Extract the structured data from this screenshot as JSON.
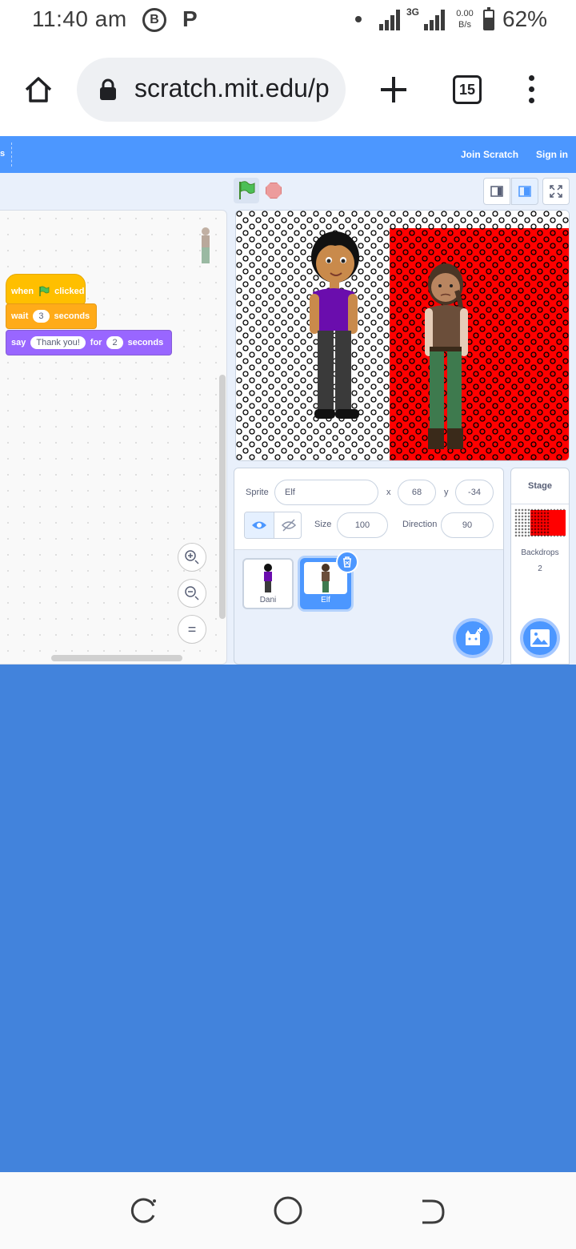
{
  "status_bar": {
    "time": "11:40 am",
    "icon_b": "B",
    "icon_p": "P",
    "network": "3G",
    "data_rate_value": "0.00",
    "data_rate_unit": "B/s",
    "battery_pct": "62%",
    "battery_level": 0.62
  },
  "browser": {
    "url": "scratch.mit.edu/p",
    "tab_count": "15"
  },
  "scratch": {
    "menu": {
      "cut_label": "s",
      "join": "Join Scratch",
      "sign_in": "Sign in"
    },
    "blocks": {
      "hat_when": "when",
      "hat_clicked": "clicked",
      "wait_label": "wait",
      "wait_value": "3",
      "wait_unit": "seconds",
      "say_label": "say",
      "say_value": "Thank you!",
      "say_for": "for",
      "say_secs_value": "2",
      "say_secs_unit": "seconds"
    },
    "zoom": {
      "zoom_in": "+",
      "zoom_out": "−",
      "reset": "="
    },
    "sprite_info": {
      "sprite_label": "Sprite",
      "sprite_name": "Elf",
      "x_label": "x",
      "x_value": "68",
      "y_label": "y",
      "y_value": "-34",
      "size_label": "Size",
      "size_value": "100",
      "direction_label": "Direction",
      "direction_value": "90"
    },
    "sprites": [
      {
        "name": "Dani",
        "selected": false
      },
      {
        "name": "Elf",
        "selected": true
      }
    ],
    "stage_panel": {
      "title": "Stage",
      "backdrops_label": "Backdrops",
      "backdrops_count": "2"
    }
  },
  "colors": {
    "scratch_blue": "#4c97ff",
    "events_yellow": "#ffbf00",
    "control_orange": "#ffab19",
    "looks_purple": "#9966ff",
    "backdrop_red": "#ff0000",
    "page_blue": "#4283dc"
  }
}
